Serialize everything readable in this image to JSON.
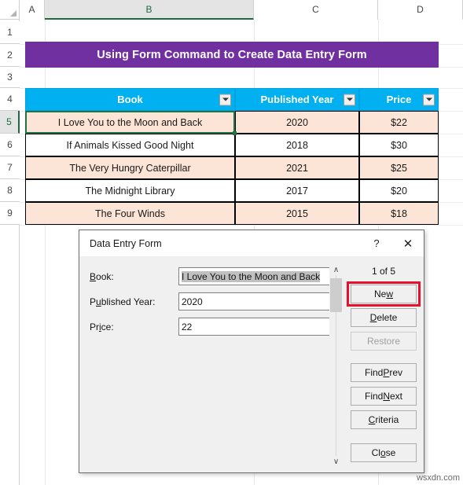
{
  "app": {
    "watermark": "wsxdn.com"
  },
  "spreadsheet": {
    "columns": [
      {
        "label": "A",
        "active": false
      },
      {
        "label": "B",
        "active": true
      },
      {
        "label": "C",
        "active": false
      },
      {
        "label": "D",
        "active": false
      }
    ],
    "rows": [
      "1",
      "2",
      "3",
      "4",
      "5",
      "6",
      "7",
      "8",
      "9"
    ],
    "active_row": "5",
    "banner": {
      "text": "Using Form Command to Create Data Entry Form",
      "bg_color": "#7030A0",
      "text_color": "#FFFFFF"
    },
    "table": {
      "header_bg": "#00B0F0",
      "header_text_color": "#FFFFFF",
      "band_color": "#FCE4D6",
      "headers": [
        "Book",
        "Published Year",
        "Price"
      ],
      "rows": [
        {
          "book": "I Love You to the Moon and Back",
          "year": "2020",
          "price": "$22",
          "banded": true
        },
        {
          "book": "If Animals Kissed Good Night",
          "year": "2018",
          "price": "$30",
          "banded": false
        },
        {
          "book": "The Very Hungry Caterpillar",
          "year": "2021",
          "price": "$25",
          "banded": true
        },
        {
          "book": "The Midnight Library",
          "year": "2017",
          "price": "$20",
          "banded": false
        },
        {
          "book": "The Four Winds",
          "year": "2015",
          "price": "$18",
          "banded": true
        }
      ]
    }
  },
  "dialog": {
    "title": "Data Entry Form",
    "help_label": "?",
    "close_label": "✕",
    "record_counter": "1 of 5",
    "fields": [
      {
        "label_pre": "",
        "label_key": "B",
        "label_post": "ook:",
        "value": "I Love You to the Moon and Back",
        "selected": true
      },
      {
        "label_pre": "P",
        "label_key": "u",
        "label_post": "blished Year:",
        "value": "2020",
        "selected": false
      },
      {
        "label_pre": "Pr",
        "label_key": "i",
        "label_post": "ce:",
        "value": "22",
        "selected": false
      }
    ],
    "field_labels": [
      "Book:",
      "Published Year:",
      "Price:"
    ],
    "field_values": [
      "I Love You to the Moon and Back",
      "2020",
      "22"
    ],
    "scrollbar": {
      "up_arrow": "∧",
      "down_arrow": "∨"
    },
    "buttons": [
      {
        "pre": "Ne",
        "key": "w",
        "post": "",
        "label": "New",
        "disabled": false,
        "highlighted": true
      },
      {
        "pre": "",
        "key": "D",
        "post": "elete",
        "label": "Delete",
        "disabled": false,
        "highlighted": false
      },
      {
        "pre": "Restore",
        "key": "",
        "post": "",
        "label": "Restore",
        "disabled": true,
        "highlighted": false
      },
      {
        "pre": "Find ",
        "key": "P",
        "post": "rev",
        "label": "Find Prev",
        "disabled": false,
        "highlighted": false
      },
      {
        "pre": "Find ",
        "key": "N",
        "post": "ext",
        "label": "Find Next",
        "disabled": false,
        "highlighted": false
      },
      {
        "pre": "",
        "key": "C",
        "post": "riteria",
        "label": "Criteria",
        "disabled": false,
        "highlighted": false
      },
      {
        "pre": "Cl",
        "key": "o",
        "post": "se",
        "label": "Close",
        "disabled": false,
        "highlighted": false
      }
    ],
    "highlight_color": "#E8112D"
  }
}
